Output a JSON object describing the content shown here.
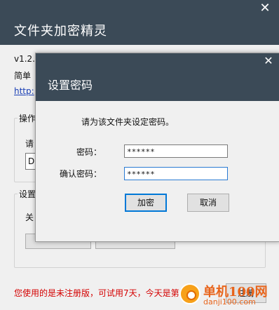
{
  "main": {
    "title": "文件夹加密精灵",
    "close_glyph": "✕",
    "version": "v1.2.",
    "description": "简单",
    "link": "http:",
    "group_ops": {
      "label": "操作",
      "line": "请",
      "field_value": "D"
    },
    "group_settings": {
      "label": "设置",
      "line": "关"
    },
    "status": "您使用的是未注册版，可试用7天，今天是第1天。",
    "register_label": "注册"
  },
  "dialog": {
    "title": "设置密码",
    "close_glyph": "✕",
    "prompt": "请为该文件夹设定密码。",
    "password_label": "密码：",
    "password_value": "******",
    "confirm_label": "确认密码：",
    "confirm_value": "******",
    "ok_label": "加密",
    "cancel_label": "取消"
  },
  "watermark": {
    "text": "单机100网",
    "sub": "danji100.com"
  }
}
